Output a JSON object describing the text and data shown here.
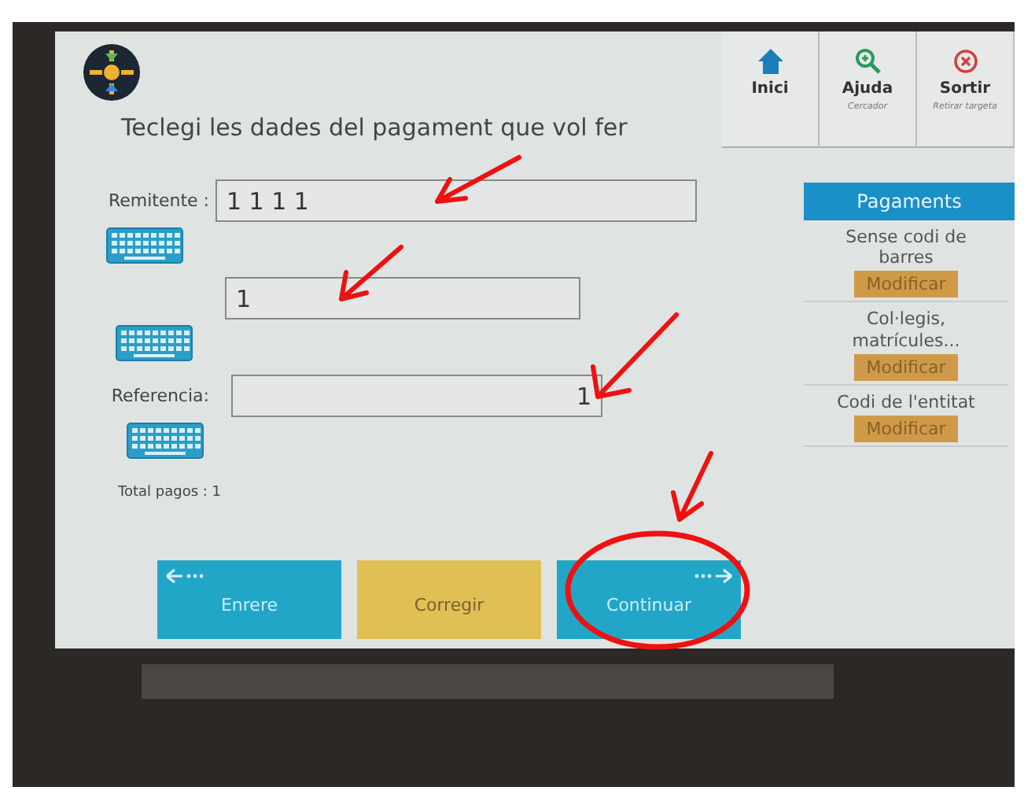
{
  "header": {
    "title": "Teclegi les dades del pagament que vol fer"
  },
  "top_buttons": [
    {
      "kind": "home",
      "label": "Inici"
    },
    {
      "kind": "help",
      "label": "Ajuda",
      "sublabel": "Cercador"
    },
    {
      "kind": "exit",
      "label": "Sortir",
      "sublabel": "Retirar targeta"
    }
  ],
  "fields": [
    {
      "label": "Remitente :",
      "value": "1 1 1 1",
      "right_aligned": false
    },
    {
      "value": "1",
      "right_aligned": false
    },
    {
      "label": "Referencia:",
      "value": "1",
      "right_aligned": true
    }
  ],
  "total": "Total pagos : 1",
  "sidebar": {
    "title": "Pagaments",
    "items": [
      {
        "text": "Sense codi de barres",
        "button": "Modificar"
      },
      {
        "text": "Col·legis, matrícules...",
        "button": "Modificar"
      },
      {
        "text": "Codi de l'entitat",
        "button": "Modificar"
      }
    ]
  },
  "bottom_buttons": [
    {
      "kind": "back",
      "label": "Enrere"
    },
    {
      "kind": "plain",
      "label": "Corregir"
    },
    {
      "kind": "next",
      "label": "Continuar"
    }
  ]
}
